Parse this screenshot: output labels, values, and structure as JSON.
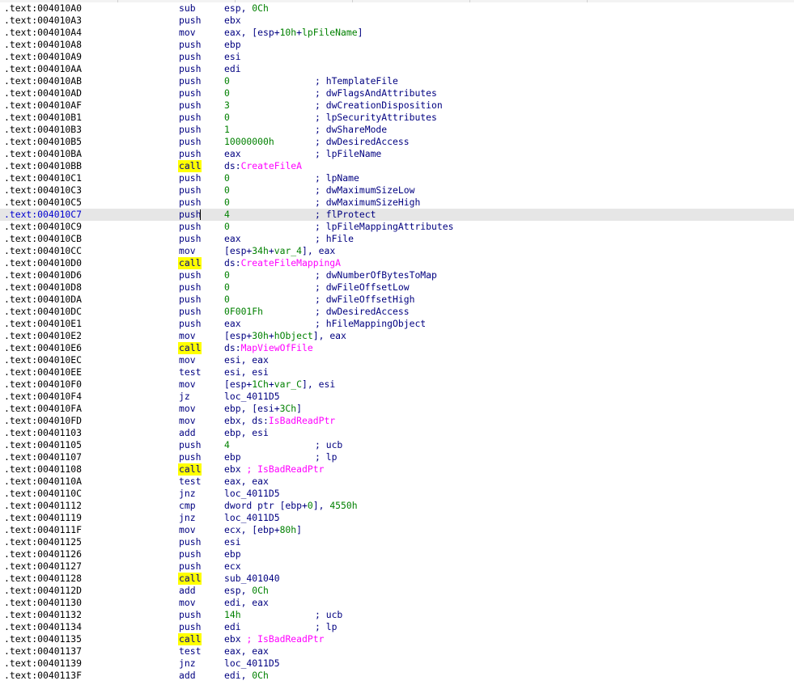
{
  "window": {
    "topbar_segments": 5
  },
  "cursor_row": 17,
  "listing": [
    {
      "addr": ".text:004010A0",
      "mnem": "sub",
      "ops": [
        [
          "esp, ",
          ""
        ],
        [
          "0Ch",
          "num"
        ]
      ],
      "cmt": ""
    },
    {
      "addr": ".text:004010A3",
      "mnem": "push",
      "ops": [
        [
          "ebx",
          ""
        ]
      ],
      "cmt": ""
    },
    {
      "addr": ".text:004010A4",
      "mnem": "mov",
      "ops": [
        [
          "eax, [esp+",
          ""
        ],
        [
          "10h",
          "num"
        ],
        [
          "+",
          ""
        ],
        [
          "lpFileName",
          "var"
        ],
        [
          "]",
          ""
        ]
      ],
      "cmt": ""
    },
    {
      "addr": ".text:004010A8",
      "mnem": "push",
      "ops": [
        [
          "ebp",
          ""
        ]
      ],
      "cmt": ""
    },
    {
      "addr": ".text:004010A9",
      "mnem": "push",
      "ops": [
        [
          "esi",
          ""
        ]
      ],
      "cmt": ""
    },
    {
      "addr": ".text:004010AA",
      "mnem": "push",
      "ops": [
        [
          "edi",
          ""
        ]
      ],
      "cmt": ""
    },
    {
      "addr": ".text:004010AB",
      "mnem": "push",
      "ops": [
        [
          "0",
          "num"
        ]
      ],
      "cmt": "; hTemplateFile"
    },
    {
      "addr": ".text:004010AD",
      "mnem": "push",
      "ops": [
        [
          "0",
          "num"
        ]
      ],
      "cmt": "; dwFlagsAndAttributes"
    },
    {
      "addr": ".text:004010AF",
      "mnem": "push",
      "ops": [
        [
          "3",
          "num"
        ]
      ],
      "cmt": "; dwCreationDisposition"
    },
    {
      "addr": ".text:004010B1",
      "mnem": "push",
      "ops": [
        [
          "0",
          "num"
        ]
      ],
      "cmt": "; lpSecurityAttributes"
    },
    {
      "addr": ".text:004010B3",
      "mnem": "push",
      "ops": [
        [
          "1",
          "num"
        ]
      ],
      "cmt": "; dwShareMode"
    },
    {
      "addr": ".text:004010B5",
      "mnem": "push",
      "ops": [
        [
          "10000000h",
          "num"
        ]
      ],
      "cmt": "; dwDesiredAccess"
    },
    {
      "addr": ".text:004010BA",
      "mnem": "push",
      "ops": [
        [
          "eax",
          ""
        ]
      ],
      "cmt": "; lpFileName"
    },
    {
      "addr": ".text:004010BB",
      "mnem": "call",
      "ops": [
        [
          "ds:",
          ""
        ],
        [
          "CreateFileA",
          "ext"
        ]
      ],
      "cmt": ""
    },
    {
      "addr": ".text:004010C1",
      "mnem": "push",
      "ops": [
        [
          "0",
          "num"
        ]
      ],
      "cmt": "; lpName"
    },
    {
      "addr": ".text:004010C3",
      "mnem": "push",
      "ops": [
        [
          "0",
          "num"
        ]
      ],
      "cmt": "; dwMaximumSizeLow"
    },
    {
      "addr": ".text:004010C5",
      "mnem": "push",
      "ops": [
        [
          "0",
          "num"
        ]
      ],
      "cmt": "; dwMaximumSizeHigh"
    },
    {
      "addr": ".text:004010C7",
      "mnem": "push",
      "ops": [
        [
          "4",
          "num"
        ]
      ],
      "cmt": "; flProtect"
    },
    {
      "addr": ".text:004010C9",
      "mnem": "push",
      "ops": [
        [
          "0",
          "num"
        ]
      ],
      "cmt": "; lpFileMappingAttributes"
    },
    {
      "addr": ".text:004010CB",
      "mnem": "push",
      "ops": [
        [
          "eax",
          ""
        ]
      ],
      "cmt": "; hFile"
    },
    {
      "addr": ".text:004010CC",
      "mnem": "mov",
      "ops": [
        [
          "[esp+",
          ""
        ],
        [
          "34h",
          "num"
        ],
        [
          "+",
          ""
        ],
        [
          "var_4",
          "var"
        ],
        [
          "], eax",
          ""
        ]
      ],
      "cmt": ""
    },
    {
      "addr": ".text:004010D0",
      "mnem": "call",
      "ops": [
        [
          "ds:",
          ""
        ],
        [
          "CreateFileMappingA",
          "ext"
        ]
      ],
      "cmt": ""
    },
    {
      "addr": ".text:004010D6",
      "mnem": "push",
      "ops": [
        [
          "0",
          "num"
        ]
      ],
      "cmt": "; dwNumberOfBytesToMap"
    },
    {
      "addr": ".text:004010D8",
      "mnem": "push",
      "ops": [
        [
          "0",
          "num"
        ]
      ],
      "cmt": "; dwFileOffsetLow"
    },
    {
      "addr": ".text:004010DA",
      "mnem": "push",
      "ops": [
        [
          "0",
          "num"
        ]
      ],
      "cmt": "; dwFileOffsetHigh"
    },
    {
      "addr": ".text:004010DC",
      "mnem": "push",
      "ops": [
        [
          "0F001Fh",
          "num"
        ]
      ],
      "cmt": "; dwDesiredAccess"
    },
    {
      "addr": ".text:004010E1",
      "mnem": "push",
      "ops": [
        [
          "eax",
          ""
        ]
      ],
      "cmt": "; hFileMappingObject"
    },
    {
      "addr": ".text:004010E2",
      "mnem": "mov",
      "ops": [
        [
          "[esp+",
          ""
        ],
        [
          "30h",
          "num"
        ],
        [
          "+",
          ""
        ],
        [
          "hObject",
          "var"
        ],
        [
          "], eax",
          ""
        ]
      ],
      "cmt": ""
    },
    {
      "addr": ".text:004010E6",
      "mnem": "call",
      "ops": [
        [
          "ds:",
          ""
        ],
        [
          "MapViewOfFile",
          "ext"
        ]
      ],
      "cmt": ""
    },
    {
      "addr": ".text:004010EC",
      "mnem": "mov",
      "ops": [
        [
          "esi, eax",
          ""
        ]
      ],
      "cmt": ""
    },
    {
      "addr": ".text:004010EE",
      "mnem": "test",
      "ops": [
        [
          "esi, esi",
          ""
        ]
      ],
      "cmt": ""
    },
    {
      "addr": ".text:004010F0",
      "mnem": "mov",
      "ops": [
        [
          "[esp+",
          ""
        ],
        [
          "1Ch",
          "num"
        ],
        [
          "+",
          ""
        ],
        [
          "var_C",
          "var"
        ],
        [
          "], esi",
          ""
        ]
      ],
      "cmt": ""
    },
    {
      "addr": ".text:004010F4",
      "mnem": "jz",
      "ops": [
        [
          "loc_4011D5",
          ""
        ]
      ],
      "cmt": ""
    },
    {
      "addr": ".text:004010FA",
      "mnem": "mov",
      "ops": [
        [
          "ebp, [esi+",
          ""
        ],
        [
          "3Ch",
          "num"
        ],
        [
          "]",
          ""
        ]
      ],
      "cmt": ""
    },
    {
      "addr": ".text:004010FD",
      "mnem": "mov",
      "ops": [
        [
          "ebx, ds:",
          ""
        ],
        [
          "IsBadReadPtr",
          "ext"
        ]
      ],
      "cmt": ""
    },
    {
      "addr": ".text:00401103",
      "mnem": "add",
      "ops": [
        [
          "ebp, esi",
          ""
        ]
      ],
      "cmt": ""
    },
    {
      "addr": ".text:00401105",
      "mnem": "push",
      "ops": [
        [
          "4",
          "num"
        ]
      ],
      "cmt": "; ucb"
    },
    {
      "addr": ".text:00401107",
      "mnem": "push",
      "ops": [
        [
          "ebp",
          ""
        ]
      ],
      "cmt": "; lp"
    },
    {
      "addr": ".text:00401108",
      "mnem": "call",
      "ops": [
        [
          "ebx ",
          ""
        ],
        [
          "; IsBadReadPtr",
          "ical"
        ]
      ],
      "cmt": ""
    },
    {
      "addr": ".text:0040110A",
      "mnem": "test",
      "ops": [
        [
          "eax, eax",
          ""
        ]
      ],
      "cmt": ""
    },
    {
      "addr": ".text:0040110C",
      "mnem": "jnz",
      "ops": [
        [
          "loc_4011D5",
          ""
        ]
      ],
      "cmt": ""
    },
    {
      "addr": ".text:00401112",
      "mnem": "cmp",
      "ops": [
        [
          "dword ptr [ebp+",
          ""
        ],
        [
          "0",
          "num"
        ],
        [
          "], ",
          ""
        ],
        [
          "4550h",
          "num"
        ]
      ],
      "cmt": ""
    },
    {
      "addr": ".text:00401119",
      "mnem": "jnz",
      "ops": [
        [
          "loc_4011D5",
          ""
        ]
      ],
      "cmt": ""
    },
    {
      "addr": ".text:0040111F",
      "mnem": "mov",
      "ops": [
        [
          "ecx, [ebp+",
          ""
        ],
        [
          "80h",
          "num"
        ],
        [
          "]",
          ""
        ]
      ],
      "cmt": ""
    },
    {
      "addr": ".text:00401125",
      "mnem": "push",
      "ops": [
        [
          "esi",
          ""
        ]
      ],
      "cmt": ""
    },
    {
      "addr": ".text:00401126",
      "mnem": "push",
      "ops": [
        [
          "ebp",
          ""
        ]
      ],
      "cmt": ""
    },
    {
      "addr": ".text:00401127",
      "mnem": "push",
      "ops": [
        [
          "ecx",
          ""
        ]
      ],
      "cmt": ""
    },
    {
      "addr": ".text:00401128",
      "mnem": "call",
      "ops": [
        [
          "sub_401040",
          ""
        ]
      ],
      "cmt": ""
    },
    {
      "addr": ".text:0040112D",
      "mnem": "add",
      "ops": [
        [
          "esp, ",
          ""
        ],
        [
          "0Ch",
          "num"
        ]
      ],
      "cmt": ""
    },
    {
      "addr": ".text:00401130",
      "mnem": "mov",
      "ops": [
        [
          "edi, eax",
          ""
        ]
      ],
      "cmt": ""
    },
    {
      "addr": ".text:00401132",
      "mnem": "push",
      "ops": [
        [
          "14h",
          "num"
        ]
      ],
      "cmt": "; ucb"
    },
    {
      "addr": ".text:00401134",
      "mnem": "push",
      "ops": [
        [
          "edi",
          ""
        ]
      ],
      "cmt": "; lp"
    },
    {
      "addr": ".text:00401135",
      "mnem": "call",
      "ops": [
        [
          "ebx ",
          ""
        ],
        [
          "; IsBadReadPtr",
          "ical"
        ]
      ],
      "cmt": ""
    },
    {
      "addr": ".text:00401137",
      "mnem": "test",
      "ops": [
        [
          "eax, eax",
          ""
        ]
      ],
      "cmt": ""
    },
    {
      "addr": ".text:00401139",
      "mnem": "jnz",
      "ops": [
        [
          "loc_4011D5",
          ""
        ]
      ],
      "cmt": ""
    },
    {
      "addr": ".text:0040113F",
      "mnem": "add",
      "ops": [
        [
          "edi, ",
          ""
        ],
        [
          "0Ch",
          "num"
        ]
      ],
      "cmt": ""
    }
  ]
}
